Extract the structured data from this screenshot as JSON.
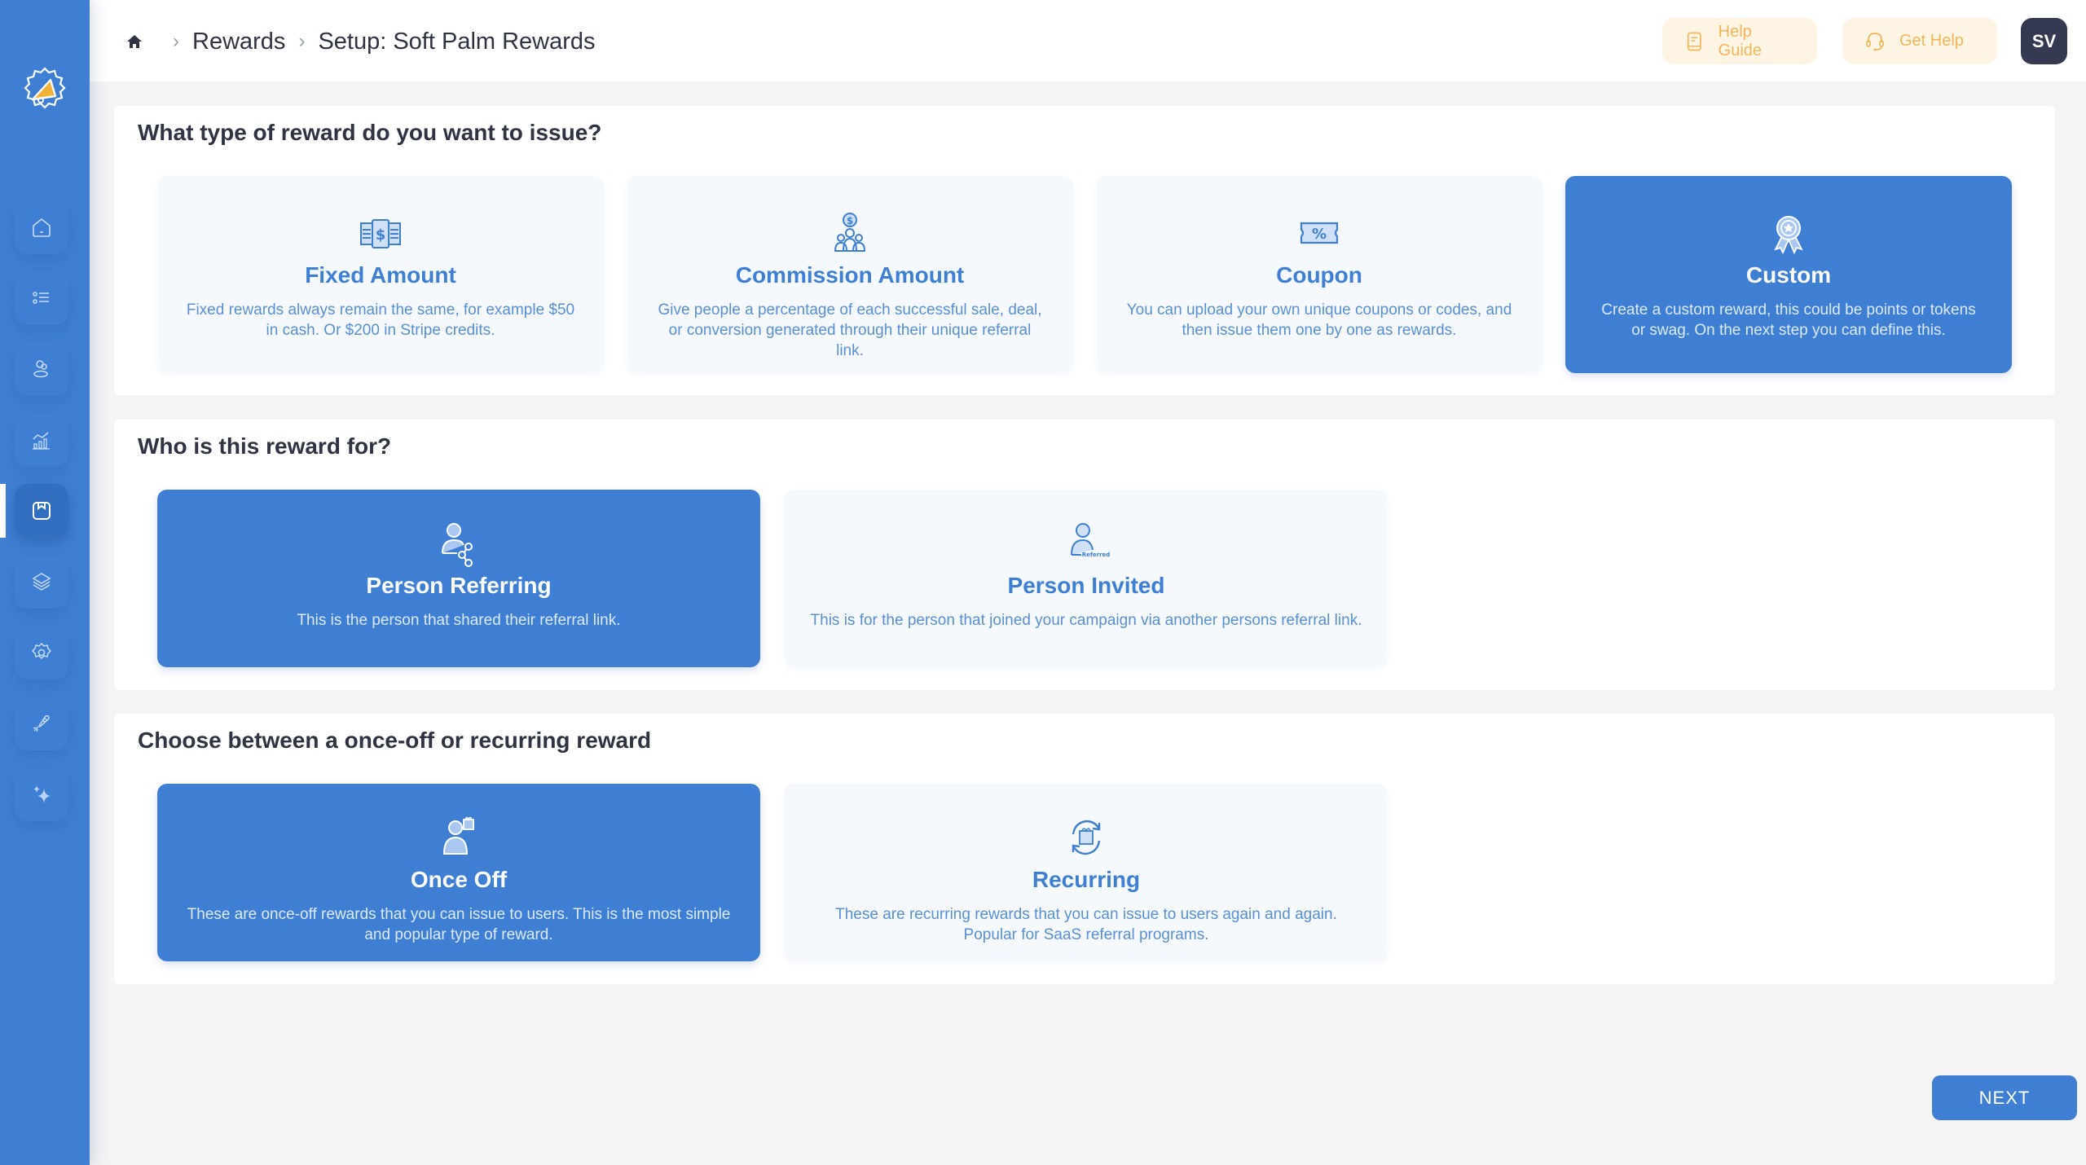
{
  "colors": {
    "primary": "#3e7fd3",
    "sidebar": "#3e7fd3",
    "card_bg": "#f5f9fd",
    "help_bg": "#fdf4e4",
    "help_fg": "#f1b55a",
    "avatar_bg": "#353a52",
    "text_dark": "#2f3342"
  },
  "sidebar": {
    "items": [
      {
        "name": "home",
        "icon": "home-icon",
        "active": false
      },
      {
        "name": "list",
        "icon": "list-icon",
        "active": false
      },
      {
        "name": "users",
        "icon": "users-icon",
        "active": false
      },
      {
        "name": "analytics",
        "icon": "chart-icon",
        "active": false
      },
      {
        "name": "rewards",
        "icon": "gift-box-icon",
        "active": true
      },
      {
        "name": "layers",
        "icon": "layers-icon",
        "active": false
      },
      {
        "name": "settings",
        "icon": "gear-icon",
        "active": false
      },
      {
        "name": "launch",
        "icon": "rocket-icon",
        "active": false
      },
      {
        "name": "ai",
        "icon": "sparkles-icon",
        "active": false
      }
    ]
  },
  "header": {
    "breadcrumb": [
      "Rewards",
      "Setup: Soft Palm Rewards"
    ],
    "help_guide_label": "Help Guide",
    "get_help_label": "Get Help",
    "avatar_initials": "SV"
  },
  "sections": [
    {
      "title": "What type of reward do you want to issue?",
      "cards": [
        {
          "title": "Fixed Amount",
          "desc": "Fixed rewards always remain the same, for example $50 in cash. Or $200 in Stripe credits.",
          "icon": "cash-icon",
          "selected": false
        },
        {
          "title": "Commission Amount",
          "desc": "Give people a percentage of each successful sale, deal, or conversion generated through their unique referral link.",
          "icon": "commission-icon",
          "selected": false
        },
        {
          "title": "Coupon",
          "desc": "You can upload your own unique coupons or codes, and then issue them one by one as rewards.",
          "icon": "coupon-icon",
          "selected": false
        },
        {
          "title": "Custom",
          "desc": "Create a custom reward, this could be points or tokens or swag. On the next step you can define this.",
          "icon": "badge-icon",
          "selected": true
        }
      ]
    },
    {
      "title": "Who is this reward for?",
      "cards": [
        {
          "title": "Person Referring",
          "desc": "This is the person that shared their referral link.",
          "icon": "person-share-icon",
          "selected": true
        },
        {
          "title": "Person Invited",
          "desc": "This is for the person that joined your campaign via another persons referral link.",
          "icon": "person-referred-icon",
          "icon_label": "Referred",
          "selected": false
        }
      ]
    },
    {
      "title": "Choose between a once-off or recurring reward",
      "cards": [
        {
          "title": "Once Off",
          "desc": "These are once-off rewards that you can issue to users. This is the most simple and popular type of reward.",
          "icon": "person-gift-icon",
          "selected": true
        },
        {
          "title": "Recurring",
          "desc": "These are recurring rewards that you can issue to users again and again. Popular for SaaS referral programs.",
          "icon": "recurring-gift-icon",
          "selected": false
        }
      ]
    }
  ],
  "footer": {
    "next_label": "NEXT"
  }
}
